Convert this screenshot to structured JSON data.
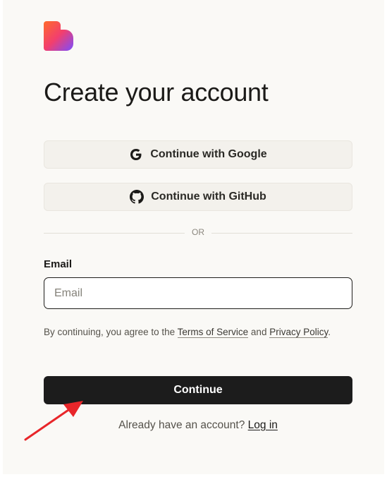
{
  "brand": {
    "logo_icon": "heart-logo-icon"
  },
  "title": "Create your account",
  "oauth": {
    "google_label": "Continue with Google",
    "google_icon": "google-icon",
    "github_label": "Continue with GitHub",
    "github_icon": "github-icon"
  },
  "divider": {
    "label": "OR"
  },
  "email": {
    "label": "Email",
    "placeholder": "Email",
    "value": ""
  },
  "terms": {
    "prefix": "By continuing, you agree to the ",
    "tos_link": "Terms of Service",
    "and": " and ",
    "privacy_link": "Privacy Policy",
    "suffix": "."
  },
  "continue_label": "Continue",
  "login": {
    "prompt": "Already have an account? ",
    "link": "Log in"
  },
  "annotation": {
    "icon": "red-arrow-icon",
    "color": "#e8262a"
  },
  "colors": {
    "button_dark": "#1c1c1c",
    "page_bg": "#faf9f6",
    "oauth_bg": "#f3f1ec"
  }
}
